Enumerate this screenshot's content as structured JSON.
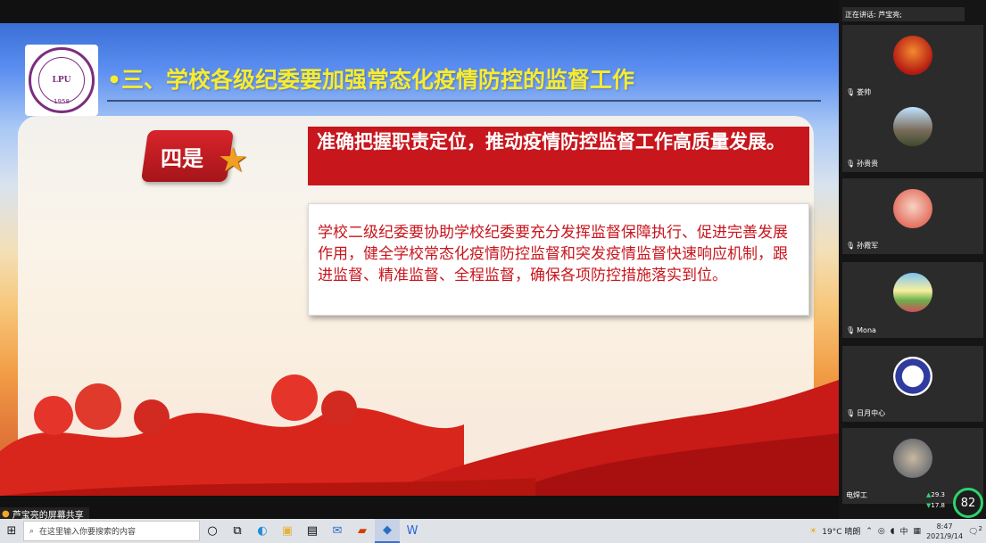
{
  "slide": {
    "title": "•三、学校各级纪委要加强常态化疫情防控的监督工作",
    "logo_year": "1958",
    "logo_mark": "LPU",
    "badge": "四是",
    "heading": "准确把握职责定位，推动疫情防控监督工作高质量发展。",
    "body": "学校二级纪委要协助学校纪委要充分发挥监督保障执行、促进完善发展作用，健全学校常态化疫情防控监督和突发疫情监督快速响应机制，跟进监督、精准监督、全程监督，确保各项防控措施落实到位。"
  },
  "meeting": {
    "speaking_label": "正在讲话: 芦宝亮;",
    "share_label": "芦宝亮的屏幕共享",
    "participants": [
      {
        "name": "娄帅",
        "icon": "muted-mic-icon"
      },
      {
        "name": "孙贵贵",
        "icon": "muted-mic-icon"
      },
      {
        "name": "孙霞军",
        "icon": "muted-mic-icon"
      },
      {
        "name": "Mona",
        "icon": "muted-mic-icon"
      },
      {
        "name": "日月中心",
        "icon": "muted-mic-icon"
      },
      {
        "name": "电焊工",
        "icon": ""
      }
    ],
    "net_up": "29.3",
    "net_down": "17.8",
    "meter_value": "82"
  },
  "taskbar": {
    "search_placeholder": "在这里输入你要搜索的内容",
    "weather": "19°C 晴朗",
    "ime": "中",
    "time": "8:47",
    "date": "2021/9/14",
    "notification_count": "2"
  },
  "colors": {
    "title_yellow": "#f7ec30",
    "accent_red": "#c8161d"
  }
}
